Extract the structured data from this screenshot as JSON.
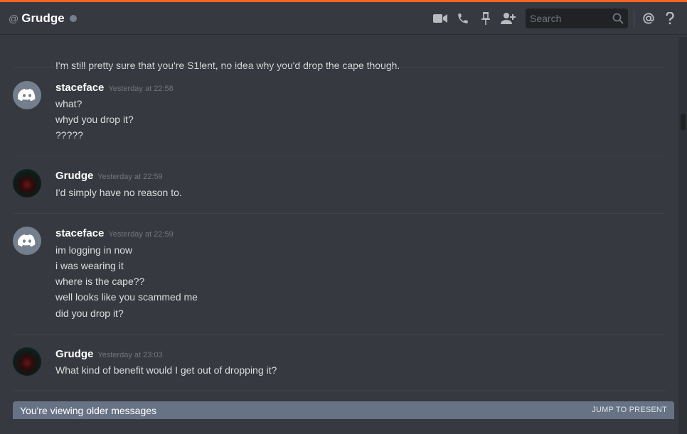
{
  "header": {
    "at_symbol": "@",
    "channel_name": "Grudge",
    "status_color": "#747f8d",
    "icons": [
      "video-call-icon",
      "phone-call-icon",
      "pin-icon",
      "add-friend-icon"
    ],
    "search_placeholder": "Search",
    "mention_icon": "at-sign-icon",
    "help_icon": "question-mark-icon"
  },
  "messages": {
    "partial_top_line": "I'm still pretty sure that you're S1lent, no idea why you'd drop the cape though.",
    "groups": [
      {
        "username": "staceface",
        "timestamp": "Yesterday at 22:58",
        "avatar": "discord-logo",
        "lines": [
          "what?",
          "whyd you drop it?",
          "?????"
        ]
      },
      {
        "username": "Grudge",
        "timestamp": "Yesterday at 22:59",
        "avatar": "dark-profile-image",
        "lines": [
          "I'd simply have no reason to."
        ]
      },
      {
        "username": "staceface",
        "timestamp": "Yesterday at 22:59",
        "avatar": "discord-logo",
        "lines": [
          "im logging in now",
          "i was wearing it",
          "where is the cape??",
          "well looks like you scammed me",
          "did you drop it?"
        ]
      },
      {
        "username": "Grudge",
        "timestamp": "Yesterday at 23:03",
        "avatar": "dark-profile-image",
        "lines": [
          "What kind of benefit would I get out of dropping it?"
        ]
      }
    ]
  },
  "older_messages_bar": {
    "text": "You're viewing older messages",
    "jump_label": "JUMP TO PRESENT"
  },
  "colors": {
    "background": "#36393f",
    "accent": "#f26522",
    "older_bar": "#677385",
    "username": "#ffffff",
    "timestamp": "#72767d"
  }
}
